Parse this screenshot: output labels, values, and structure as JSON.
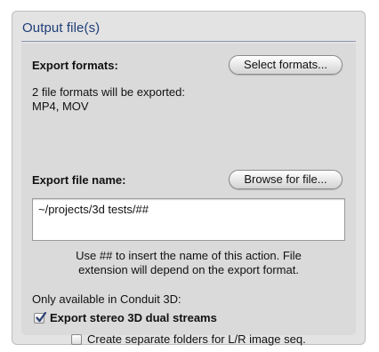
{
  "section": {
    "title": "Output file(s)"
  },
  "export_formats": {
    "label": "Export formats:",
    "button_label": "Select formats...",
    "summary_line1": "2 file formats will be exported:",
    "summary_line2": "MP4, MOV"
  },
  "export_file_name": {
    "label": "Export file name:",
    "button_label": "Browse for file...",
    "value": "~/projects/3d tests/##",
    "hint_line1": "Use ## to insert the name of this action. File",
    "hint_line2": "extension will depend on the export format."
  },
  "conduit3d": {
    "note": "Only available in Conduit 3D:",
    "stereo_checkbox": {
      "label": "Export stereo 3D dual streams",
      "checked": true
    },
    "folders_checkbox": {
      "label": "Create separate folders for L/R image seq.",
      "checked": false
    }
  },
  "colors": {
    "title": "#1f3d78",
    "panel": "#e3e3e3",
    "checkmark": "#2a3f73"
  }
}
